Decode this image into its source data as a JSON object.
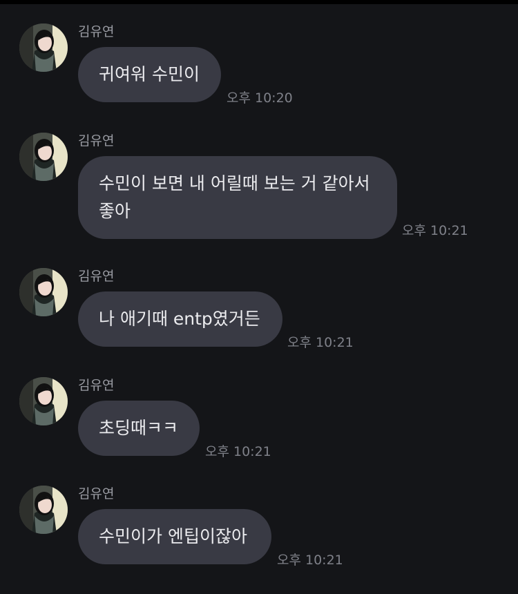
{
  "sender_name": "김유연",
  "messages": [
    {
      "lines": [
        "귀여워 수민이"
      ],
      "time": "오후 10:20"
    },
    {
      "lines": [
        "수민이 보면 내 어릴때 보는 거 같아서",
        "좋아"
      ],
      "time": "오후 10:21"
    },
    {
      "lines": [
        "나 애기때 entp였거든"
      ],
      "time": "오후 10:21"
    },
    {
      "lines": [
        "초딩때ㅋㅋ"
      ],
      "time": "오후 10:21"
    },
    {
      "lines": [
        "수민이가 엔팁이잖아"
      ],
      "time": "오후 10:21"
    }
  ],
  "colors": {
    "background": "#141518",
    "bubble": "#393a44",
    "text": "#ececef",
    "sender": "#9a9ca3",
    "time": "#7f8189"
  }
}
